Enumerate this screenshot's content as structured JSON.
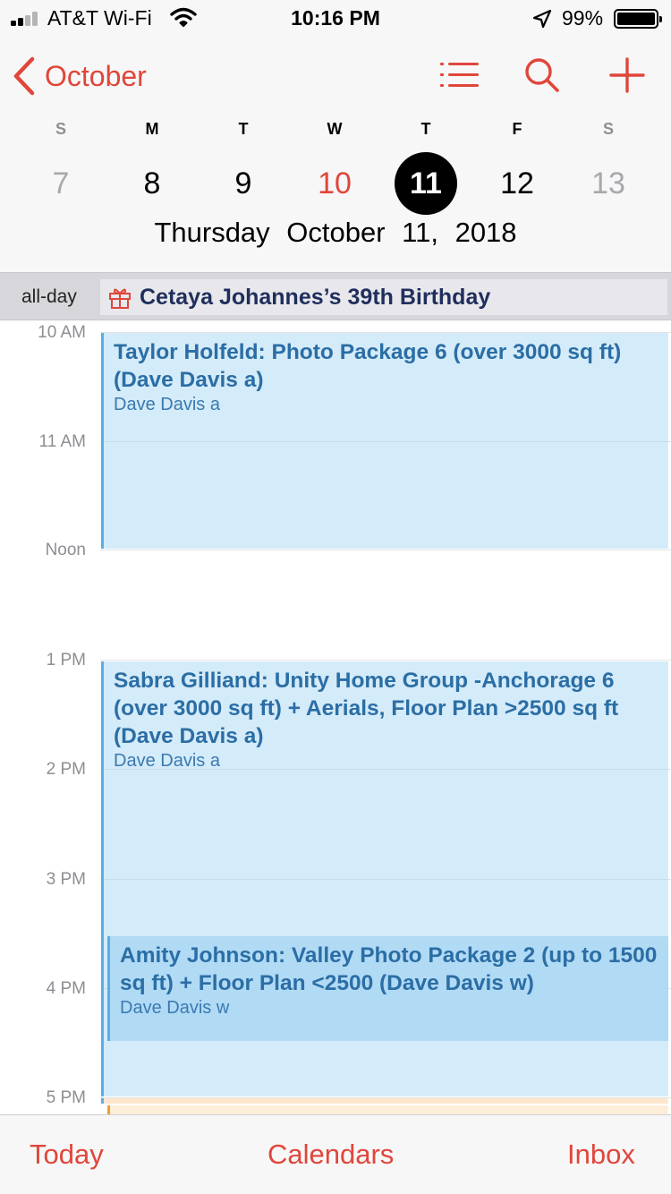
{
  "status_bar": {
    "carrier": "AT&T Wi-Fi",
    "time": "10:16 PM",
    "battery": "99%"
  },
  "header": {
    "back_label": "October",
    "icons": [
      "list-icon",
      "search-icon",
      "add-icon"
    ],
    "weekdays": [
      "S",
      "M",
      "T",
      "W",
      "T",
      "F",
      "S"
    ],
    "dates": [
      "7",
      "8",
      "9",
      "10",
      "11",
      "12",
      "13"
    ],
    "full_date": "Thursday October 11, 2018"
  },
  "all_day": {
    "label": "all-day",
    "event": "Cetaya Johannes’s 39th Birthday"
  },
  "timeline": {
    "hours": [
      "10 AM",
      "11 AM",
      "Noon",
      "1 PM",
      "2 PM",
      "3 PM",
      "4 PM",
      "5 PM"
    ],
    "events": [
      {
        "title": "Taylor Holfeld: Photo Package 6 (over 3000 sq ft) (Dave Davis a)",
        "calendar": "Dave Davis a",
        "start": "10 AM",
        "end": "Noon"
      },
      {
        "title": "Sabra Gilliand: Unity Home Group -Anchorage 6 (over 3000 sq ft) + Aerials, Floor Plan >2500 sq ft (Dave Davis a)",
        "calendar": "Dave Davis a",
        "start": "1 PM",
        "end": "5 PM"
      },
      {
        "title": "Amity Johnson: Valley Photo Package 2 (up to 1500 sq ft) + Floor Plan <2500 (Dave Davis w)",
        "calendar": "Dave Davis w",
        "start": "3:30 PM",
        "end": "4:30 PM"
      }
    ]
  },
  "tabbar": {
    "today": "Today",
    "calendars": "Calendars",
    "inbox": "Inbox"
  },
  "colors": {
    "accent": "#e0463b",
    "event_fill": "#d6ebfa",
    "event_border": "#5aaee8",
    "event_text": "#2b6ea5",
    "selected_date_bg": "#000000"
  }
}
